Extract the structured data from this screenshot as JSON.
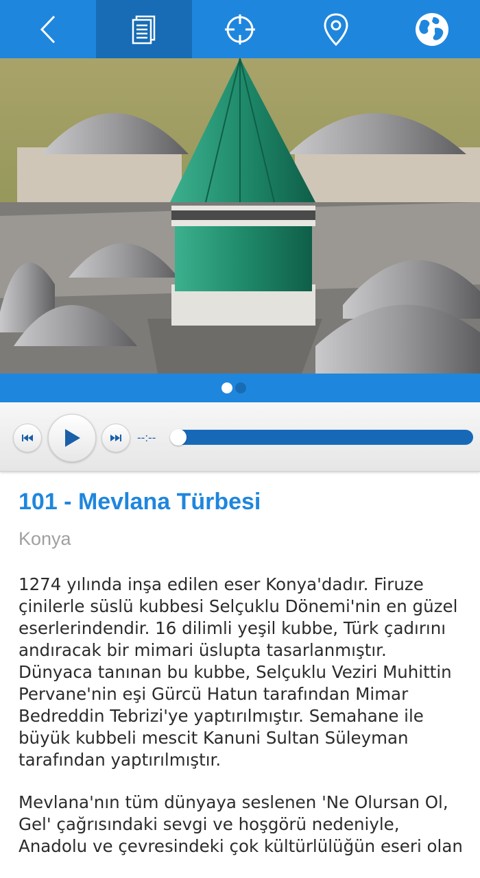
{
  "nav": {
    "items": [
      {
        "icon": "back-arrow-icon",
        "active": false
      },
      {
        "icon": "document-icon",
        "active": true
      },
      {
        "icon": "crosshair-icon",
        "active": false
      },
      {
        "icon": "map-pin-icon",
        "active": false
      },
      {
        "icon": "globe-icon",
        "active": false
      }
    ]
  },
  "gallery": {
    "page_count": 2,
    "current_page": 1
  },
  "player": {
    "time": "--:--",
    "progress": 0
  },
  "place": {
    "title": "101 - Mevlana Türbesi",
    "city": "Konya",
    "paragraphs": [
      "1274 yılında inşa edilen eser Konya'dadır. Firuze çinilerle süslü kubbesi Selçuklu Dönemi'nin en güzel eserlerindendir. 16 dilimli yeşil kubbe, Türk çadırını andıracak bir mimari üslupta tasarlanmıştır. Dünyaca tanınan bu kubbe, Selçuklu Veziri Muhittin Pervane'nin eşi Gürcü Hatun tarafından Mimar Bedreddin Tebrizi'ye yaptırılmıştır. Semahane ile büyük kubbeli mescit Kanuni Sultan Süleyman tarafından yaptırılmıştır.",
      "Mevlana'nın tüm dünyaya seslenen 'Ne Olursan Ol, Gel' çağrısındaki sevgi ve hoşgörü nedeniyle, Anadolu ve çevresindeki çok kültürlülüğün eseri olan"
    ]
  },
  "colors": {
    "primary": "#1f86dd",
    "active_tab": "#176cb5",
    "tile_green": "#1f8a6a",
    "dome_gray": "#8e8e90"
  }
}
